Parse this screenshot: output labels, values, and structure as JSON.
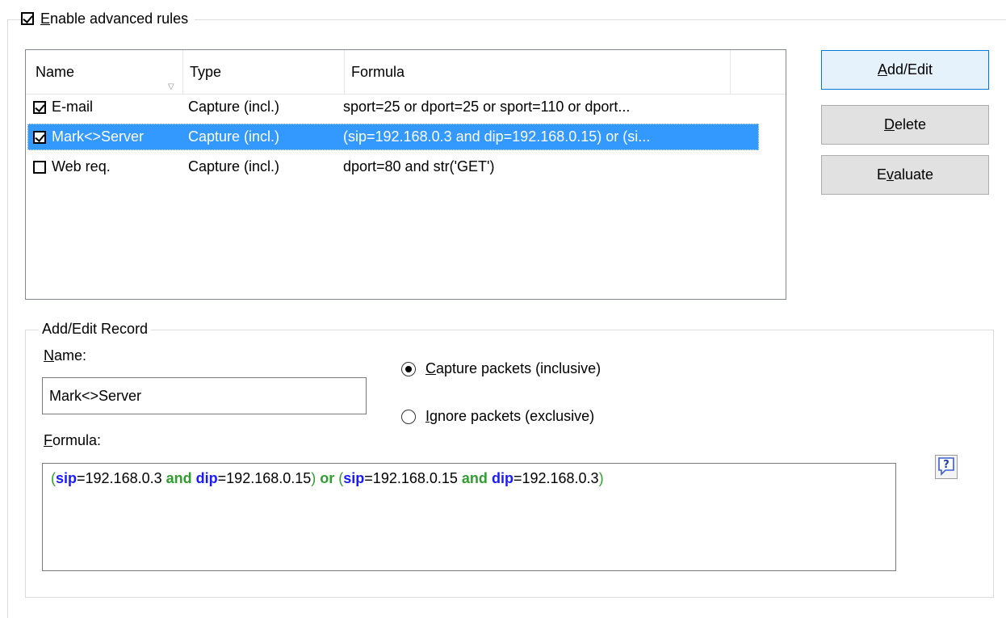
{
  "enable_advanced_rules": {
    "label_u": "E",
    "label_rest": "nable advanced rules",
    "checked": true
  },
  "list": {
    "columns": [
      {
        "label": "Name"
      },
      {
        "label": "Type"
      },
      {
        "label": "Formula"
      }
    ],
    "rows": [
      {
        "checked": true,
        "name": "E-mail",
        "type": "Capture (incl.)",
        "formula": "sport=25 or dport=25 or sport=110 or dport...",
        "selected": false
      },
      {
        "checked": true,
        "name": "Mark<>Server",
        "type": "Capture (incl.)",
        "formula": "(sip=192.168.0.3 and dip=192.168.0.15) or (si...",
        "selected": true
      },
      {
        "checked": false,
        "name": "Web req.",
        "type": "Capture (incl.)",
        "formula": "dport=80 and str('GET')",
        "selected": false
      }
    ]
  },
  "buttons": {
    "add_edit": {
      "u": "A",
      "rest": "dd/Edit"
    },
    "delete": {
      "u": "D",
      "rest": "elete"
    },
    "evaluate": {
      "pre": "E",
      "u": "v",
      "rest": "aluate"
    }
  },
  "record": {
    "legend": "Add/Edit Record",
    "name_label_u": "N",
    "name_label_rest": "ame:",
    "name_value": "Mark<>Server",
    "capture_u": "C",
    "capture_rest": "apture packets (inclusive)",
    "ignore_u": "I",
    "ignore_rest": "gnore packets (exclusive)",
    "capture_selected": true,
    "formula_label_u": "F",
    "formula_label_rest": "ormula:",
    "formula_tokens": [
      {
        "t": "(",
        "k": "paren"
      },
      {
        "t": "sip",
        "k": "var"
      },
      {
        "t": "=192.168.0.3 ",
        "k": "num"
      },
      {
        "t": "and",
        "k": "kw"
      },
      {
        "t": " ",
        "k": "num"
      },
      {
        "t": "dip",
        "k": "var"
      },
      {
        "t": "=192.168.0.15",
        "k": "num"
      },
      {
        "t": ") ",
        "k": "paren"
      },
      {
        "t": "or",
        "k": "kw"
      },
      {
        "t": " (",
        "k": "paren"
      },
      {
        "t": "sip",
        "k": "var"
      },
      {
        "t": "=192.168.0.15 ",
        "k": "num"
      },
      {
        "t": "and",
        "k": "kw"
      },
      {
        "t": " ",
        "k": "num"
      },
      {
        "t": "dip",
        "k": "var"
      },
      {
        "t": "=192.168.0.3",
        "k": "num"
      },
      {
        "t": ")",
        "k": "paren"
      }
    ],
    "help_icon": "help-question-icon"
  },
  "colors": {
    "selection": "#3399ff",
    "keyword": "#2f9e2f",
    "variable": "#1a1aff"
  }
}
